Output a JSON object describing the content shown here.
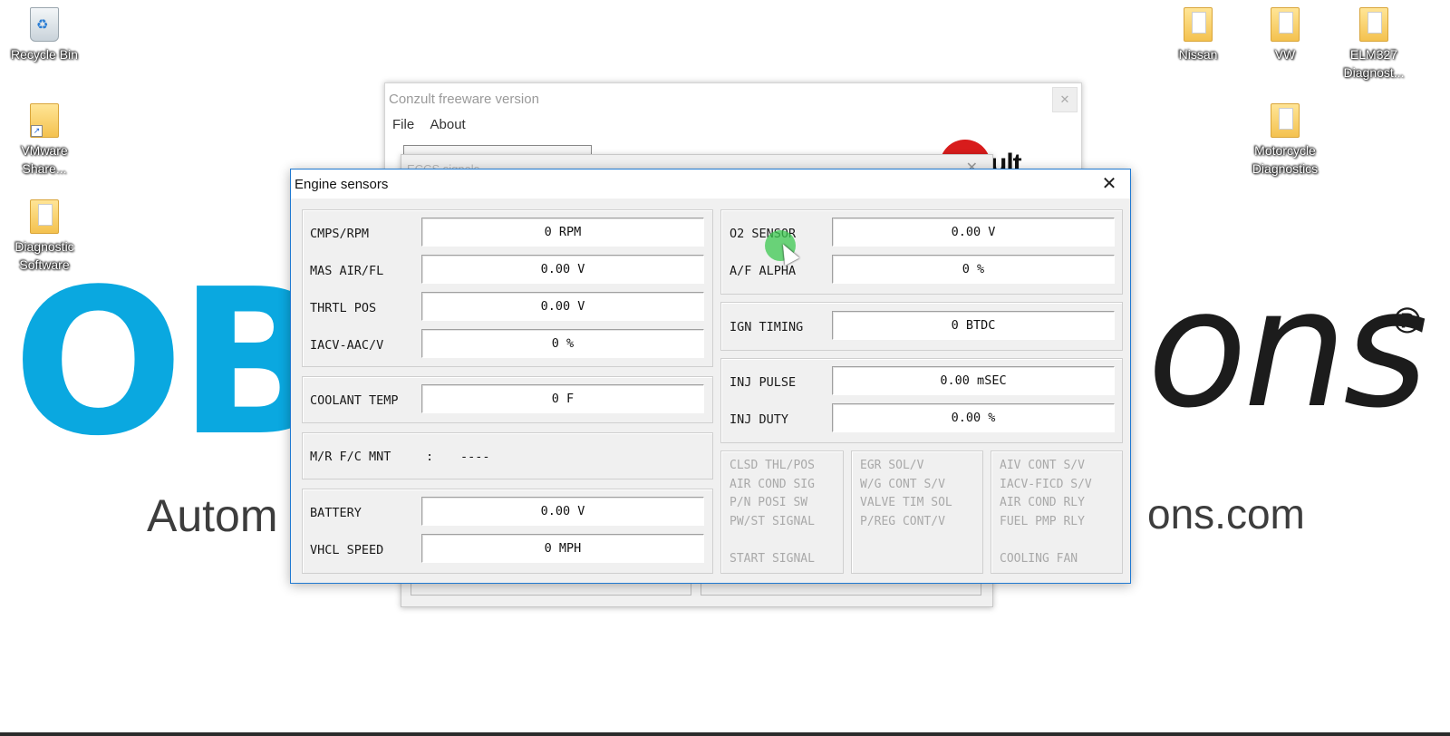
{
  "wallpaper": {
    "brand_left": "OBD",
    "brand_right": "ons",
    "registered": "®",
    "tagline_left": "Autom",
    "tagline_right": "ons.com"
  },
  "desktop_icons": [
    {
      "label": "Recycle Bin",
      "icon": "recycle-bin-icon"
    },
    {
      "label": "VMware Share...",
      "icon": "folder-shortcut-icon"
    },
    {
      "label": "Diagnostic Software",
      "icon": "folder-icon"
    },
    {
      "label": "Nissan",
      "icon": "folder-icon"
    },
    {
      "label": "VW",
      "icon": "folder-icon"
    },
    {
      "label": "ELM327 Diagnost...",
      "icon": "folder-icon"
    },
    {
      "label": "Motorcycle Diagnostics",
      "icon": "folder-icon"
    }
  ],
  "background_window": {
    "title": "Conzult freeware version",
    "menu": [
      "File",
      "About"
    ],
    "close_label": "✕"
  },
  "eccs_window": {
    "title": "ECCS signals",
    "close_label": "✕"
  },
  "engine_window": {
    "title": "Engine sensors",
    "close_label": "✕",
    "left_group1": [
      {
        "label": "CMPS/RPM",
        "value": "0 RPM"
      },
      {
        "label": "MAS AIR/FL",
        "value": "0.00 V"
      },
      {
        "label": "THRTL POS",
        "value": "0.00 V"
      },
      {
        "label": "IACV-AAC/V",
        "value": "0 %"
      }
    ],
    "left_group2": [
      {
        "label": "COOLANT TEMP",
        "value": "0 F"
      }
    ],
    "mr_fc": {
      "label": "M/R F/C MNT",
      "sep": ":",
      "value": "----"
    },
    "left_group4": [
      {
        "label": "BATTERY",
        "value": "0.00 V"
      },
      {
        "label": "VHCL SPEED",
        "value": "0 MPH"
      }
    ],
    "right_group1": [
      {
        "label": "O2 SENSOR",
        "value": "0.00 V"
      },
      {
        "label": "A/F ALPHA",
        "value": "0 %"
      }
    ],
    "right_group2": [
      {
        "label": "IGN TIMING",
        "value": "0 BTDC"
      }
    ],
    "right_group3": [
      {
        "label": "INJ PULSE",
        "value": "0.00 mSEC"
      },
      {
        "label": "INJ DUTY",
        "value": "0.00 %"
      }
    ],
    "switches": {
      "col1": [
        "CLSD THL/POS",
        "AIR COND SIG",
        "P/N POSI SW",
        "PW/ST SIGNAL",
        "",
        "START SIGNAL"
      ],
      "col2": [
        "EGR SOL/V",
        "W/G CONT S/V",
        "VALVE TIM SOL",
        "P/REG CONT/V"
      ],
      "col3": [
        "AIV CONT S/V",
        "IACV-FICD S/V",
        "AIR COND RLY",
        "FUEL PMP RLY",
        "",
        "COOLING FAN"
      ]
    }
  }
}
